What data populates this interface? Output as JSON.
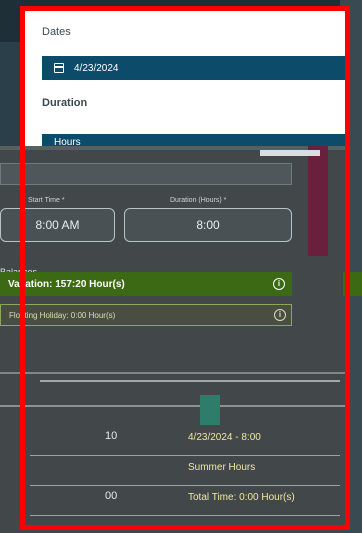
{
  "form": {
    "dates_label": "Dates",
    "date_value": "4/23/2024",
    "duration_label": "Duration",
    "duration_unit": "Hours"
  },
  "times": {
    "start_label": "Start Time *",
    "start_value": "8:00 AM",
    "duration_label": "Duration (Hours) *",
    "duration_value": "8:00"
  },
  "balances": {
    "section_label": "Balances",
    "vacation_text": "Vacation: 157:20 Hour(s)",
    "holiday_text": "Floating Holiday: 0:00 Hour(s)"
  },
  "rows": [
    {
      "num": "10",
      "text": "4/23/2024 - 8:00"
    },
    {
      "num": "",
      "text": "Summer Hours"
    },
    {
      "num": "00",
      "text": "Total Time: 0:00 Hour(s)"
    }
  ],
  "colors": {
    "frame": "#ff0000",
    "primary_field": "#0d4b6a",
    "vacation": "#3c6a14"
  }
}
